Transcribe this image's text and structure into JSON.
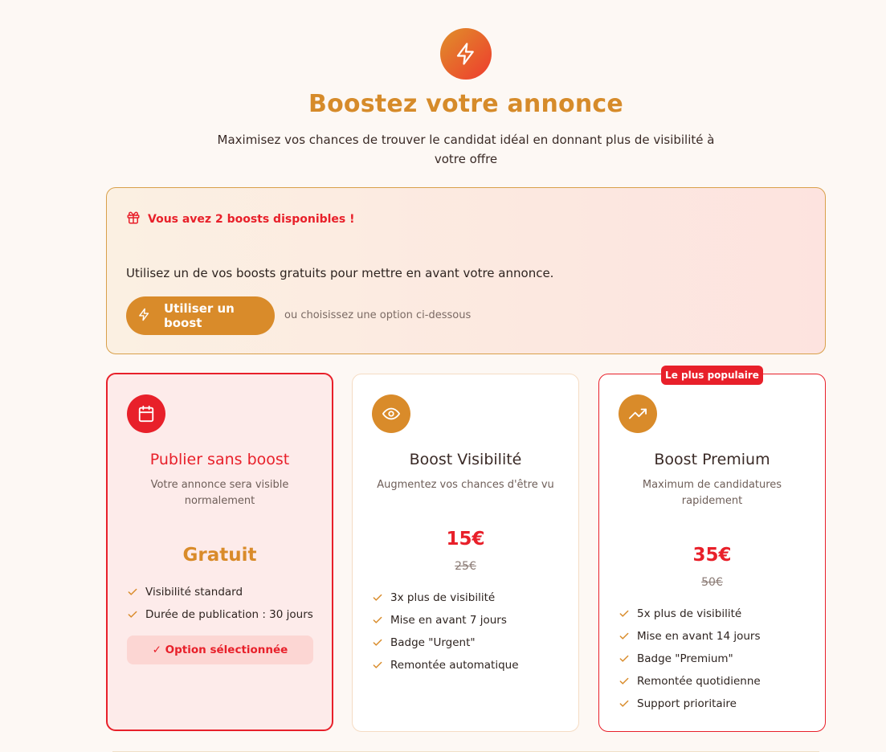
{
  "header": {
    "icon": "lightning-icon",
    "title": "Boostez votre annonce",
    "subtitle": "Maximisez vos chances de trouver le candidat idéal en donnant plus de visibilité à votre offre"
  },
  "promo": {
    "icon": "gift-icon",
    "heading": "Vous avez 2 boosts disponibles !",
    "text": "Utilisez un de vos boosts gratuits pour mettre en avant votre annonce.",
    "button_label": "Utiliser un boost",
    "alt_text": "ou choisissez une option ci-dessous"
  },
  "plans": [
    {
      "icon": "calendar-icon",
      "name": "Publier sans boost",
      "description": "Votre annonce sera visible normalement",
      "price": "Gratuit",
      "features": [
        "Visibilité standard",
        "Durée de publication : 30 jours"
      ],
      "selected_label": "✓ Option sélectionnée"
    },
    {
      "icon": "eye-icon",
      "name": "Boost Visibilité",
      "description": "Augmentez vos chances d'être vu",
      "price": "15€",
      "old_price": "25€",
      "features": [
        "3x plus de visibilité",
        "Mise en avant 7 jours",
        "Badge \"Urgent\"",
        "Remontée automatique"
      ]
    },
    {
      "icon": "trending-up-icon",
      "badge": "Le plus populaire",
      "name": "Boost Premium",
      "description": "Maximum de candidatures rapidement",
      "price": "35€",
      "old_price": "50€",
      "features": [
        "5x plus de visibilité",
        "Mise en avant 14 jours",
        "Badge \"Premium\"",
        "Remontée quotidienne",
        "Support prioritaire"
      ]
    }
  ],
  "colors": {
    "accent_orange": "#d98b2a",
    "accent_red": "#e8202a",
    "background": "#fdf8f4"
  }
}
